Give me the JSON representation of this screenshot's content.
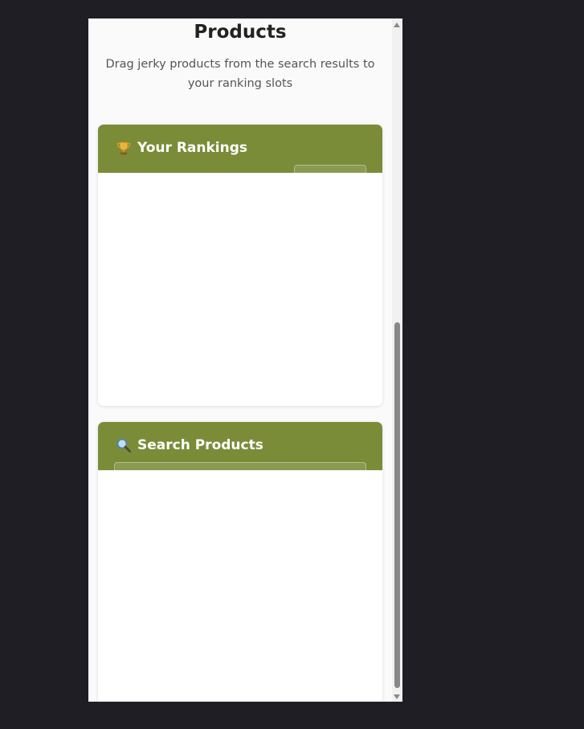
{
  "page": {
    "title": "Products",
    "subtitle": "Drag jerky products from the search results to your ranking slots"
  },
  "rankings": {
    "icon": "trophy-icon",
    "title": "Your Rankings"
  },
  "search": {
    "icon": "magnifier-icon",
    "title": "Search Products"
  },
  "colors": {
    "accent": "#7a8c38",
    "background": "#1e1e24",
    "card": "#ffffff"
  }
}
